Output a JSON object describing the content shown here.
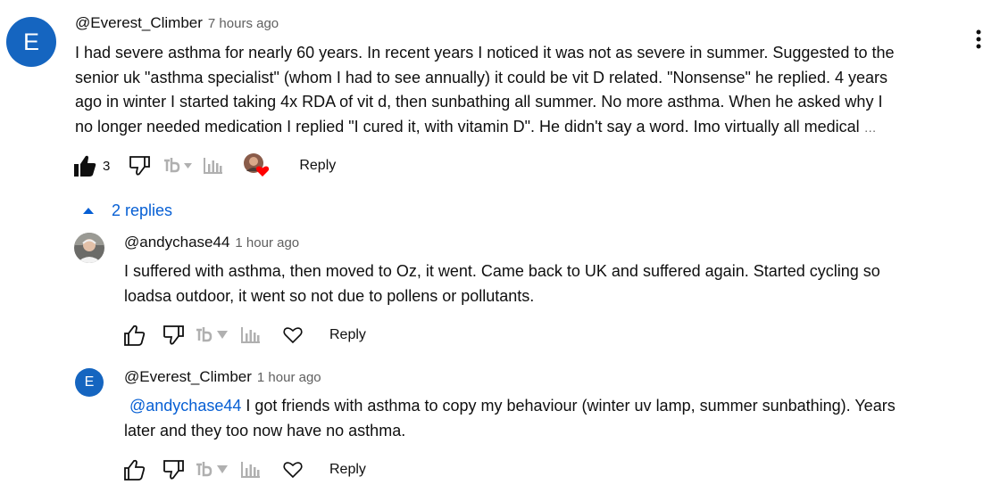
{
  "main_comment": {
    "avatar_letter": "E",
    "author": "@Everest_Climber",
    "time": "7 hours ago",
    "lines": [
      "I had severe asthma for nearly 60 years. In recent years I noticed it was not as severe in summer. Suggested to the",
      "senior uk \"asthma specialist\" (whom I had to see annually) it could be vit D related. \"Nonsense\" he replied. 4 years",
      "ago in winter I started taking 4x RDA of vit d, then sunbathing all summer. No more asthma. When he asked why I",
      "no longer needed medication I replied \"I cured it, with vitamin D\". He didn't say a word. Imo virtually all medical"
    ],
    "ellipsis": "…",
    "like_count": "3",
    "reply_label": "Reply"
  },
  "replies_toggle": {
    "label": "2 replies"
  },
  "reply1": {
    "author": "@andychase44",
    "time": "1 hour ago",
    "lines": [
      "I suffered with asthma, then moved to Oz, it went. Came back to UK and suffered again. Started cycling so",
      "loadsa outdoor, it went so not due to pollens or pollutants."
    ],
    "reply_label": "Reply"
  },
  "reply2": {
    "avatar_letter": "E",
    "author": "@Everest_Climber",
    "time": "1 hour ago",
    "mention": "@andychase44",
    "line1_rest": " I got friends with asthma to copy my behaviour (winter uv lamp, summer sunbathing). Years",
    "line2": "later and they too now have no asthma.",
    "reply_label": "Reply"
  },
  "icons": {
    "kebab": "more-vert-icon",
    "like": "thumb-up-icon",
    "dislike": "thumb-down-icon",
    "tb": "tb-icon",
    "stats": "stats-icon",
    "heart": "heart-icon"
  },
  "colors": {
    "accent": "#065fd4",
    "avatar": "#1565c0",
    "heart": "#ff0000"
  }
}
